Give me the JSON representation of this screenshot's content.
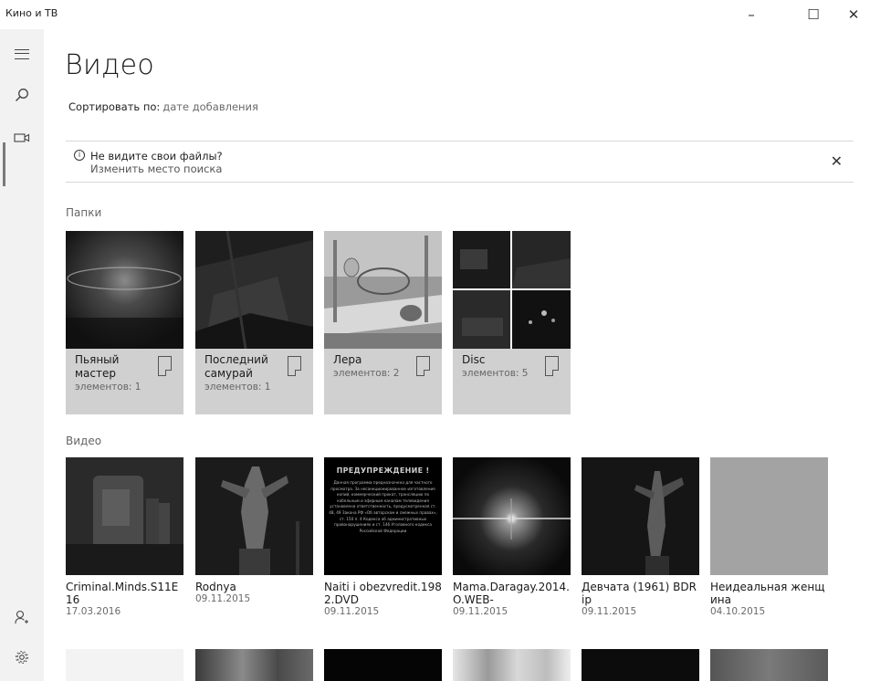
{
  "window": {
    "title": "Кино и ТВ",
    "min_glyph": "–",
    "max_glyph": "☐",
    "close_glyph": "✕"
  },
  "rail": {
    "items": [
      "menu-icon",
      "search-icon",
      "video-icon",
      "account-icon",
      "settings-icon"
    ],
    "active": "video-icon"
  },
  "page": {
    "title": "Видео",
    "sort_label": "Сортировать по:",
    "sort_value": "дате добавления"
  },
  "notice": {
    "icon_glyph": "i",
    "title": "Не видите свои файлы?",
    "link": "Изменить место поиска",
    "close_glyph": "✕"
  },
  "folders": {
    "section_title": "Папки",
    "items": [
      {
        "name": "Пьяный мастер",
        "count": "элементов: 1"
      },
      {
        "name": "Последний самурай",
        "count": "элементов: 1"
      },
      {
        "name": "Лера",
        "count": "элементов: 2"
      },
      {
        "name": "Disc",
        "count": "элементов: 5"
      }
    ]
  },
  "videos": {
    "section_title": "Видео",
    "items": [
      {
        "name": "Criminal.Minds.S11E16",
        "date": "17.03.2016"
      },
      {
        "name": "Rodnya",
        "date": "09.11.2015"
      },
      {
        "name": "Naiti i obezvredit.1982.DVD",
        "date": "09.11.2015"
      },
      {
        "name": "Mama.Daragay.2014.O.WEB-",
        "date": "09.11.2015"
      },
      {
        "name": "Девчата (1961) BDRip",
        "date": "09.11.2015"
      },
      {
        "name": "Неидеальная женщина",
        "date": "04.10.2015"
      }
    ],
    "warning_thumb": {
      "title": "ПРЕДУПРЕЖДЕНИЕ !",
      "text": "Данная программа предназначена для частного просмотра. За несанкционированное изготовление копий, коммерческий прокат, трансляцию по кабельным и эфирным каналам телевидения установлена ответственность, предусмотренная ст. 48, 49 Закона РФ «Об авторском и смежных правах», ст. 150 п. 4 Кодекса об административных правонарушениях и ст. 146 Уголовного кодекса Российской Федерации"
    }
  }
}
